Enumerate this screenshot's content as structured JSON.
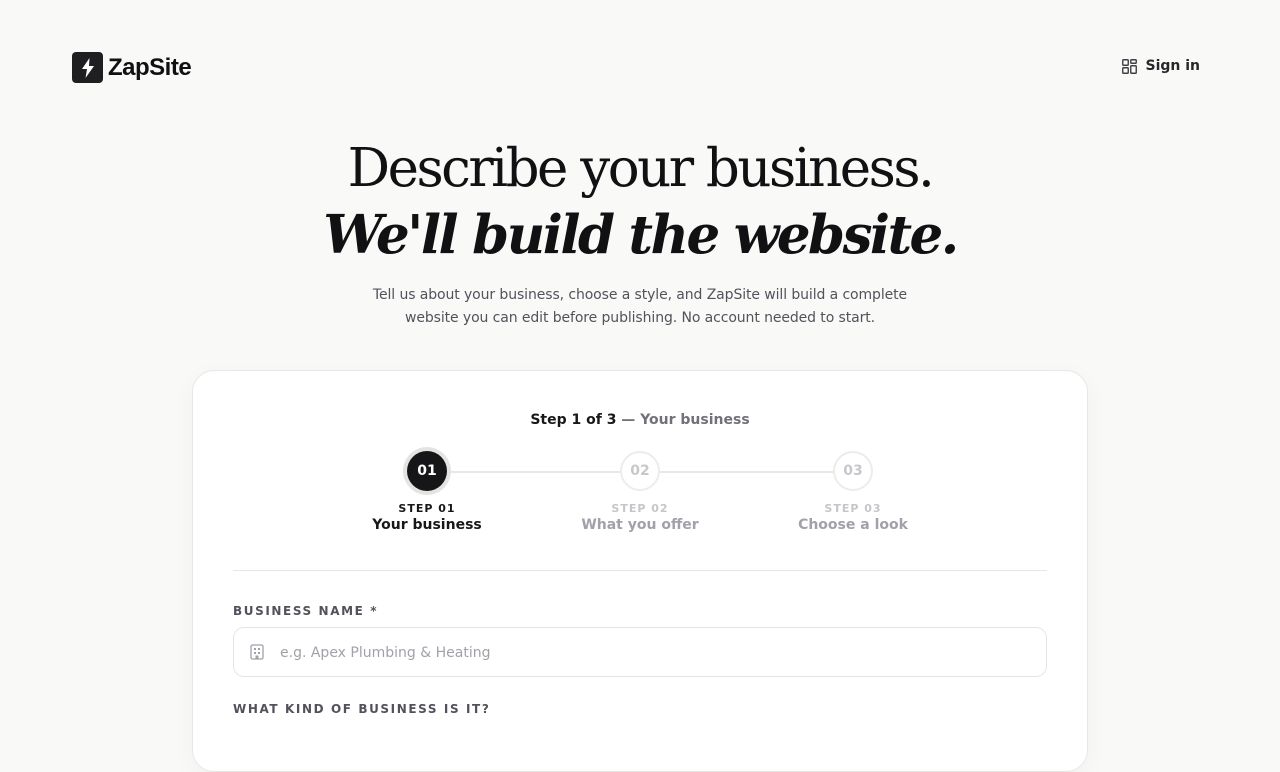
{
  "brand": {
    "name": "ZapSite"
  },
  "header": {
    "signin_label": "Sign in"
  },
  "hero": {
    "line1": "Describe your business.",
    "line2": "We'll build the website.",
    "subtitle": "Tell us about your business, choose a style, and ZapSite will build a complete website you can edit before publishing. No account needed to start."
  },
  "wizard": {
    "caption_main": "Step 1 of 3",
    "caption_sep": " — ",
    "caption_current": "Your business",
    "steps": [
      {
        "number": "01",
        "small": "STEP 01",
        "label": "Your business",
        "state": "active"
      },
      {
        "number": "02",
        "small": "STEP 02",
        "label": "What you offer",
        "state": "inactive"
      },
      {
        "number": "03",
        "small": "STEP 03",
        "label": "Choose a look",
        "state": "inactive"
      }
    ]
  },
  "form": {
    "business_name_label": "BUSINESS NAME *",
    "business_name_placeholder": "e.g. Apex Plumbing & Heating",
    "business_name_value": "",
    "business_kind_label": "WHAT KIND OF BUSINESS IS IT?"
  },
  "icons": {
    "logo": "lightning-bolt-icon",
    "signin": "grid-icon",
    "business_name": "building-icon"
  },
  "colors": {
    "background": "#f9f9f8",
    "accent": "#161618",
    "muted": "#71717a"
  }
}
